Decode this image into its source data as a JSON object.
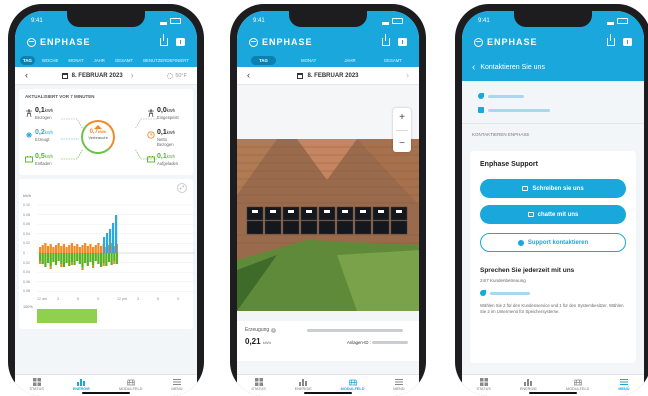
{
  "status": {
    "time": "9:41"
  },
  "brand": {
    "name": "ENPHASE",
    "color": "#1aa7dc"
  },
  "phone1": {
    "tabs": [
      "TAG",
      "WOCHE",
      "MONAT",
      "JAHR",
      "GESAMT",
      "BENUTZERDEFINIERT"
    ],
    "active_tab": "TAG",
    "date": "8. FEBRUAR 2023",
    "temperature": "50°F",
    "updated": "AKTUALISIERT VOR 7 MINUTEN",
    "flows": {
      "bezogen": {
        "value": "0,1",
        "unit": "kWh",
        "label": "Bezogen"
      },
      "eingespeist": {
        "value": "0,0",
        "unit": "kWh",
        "label": "Eingespeist"
      },
      "erzeugt": {
        "value": "0,2",
        "unit": "kWh",
        "label": "Erzeugt"
      },
      "netto": {
        "value": "0,1",
        "unit": "kWh",
        "label": "Netto Bezogen"
      },
      "entladen": {
        "value": "0,5",
        "unit": "kWh",
        "label": "Entladen"
      },
      "aufgeladen": {
        "value": "0,1",
        "unit": "kWh",
        "label": "Aufgeladen"
      },
      "verbraucht": {
        "value": "0,7",
        "unit": "kWh",
        "label": "Verbraucht"
      }
    },
    "chart": {
      "unit_label": "kWh",
      "y_ticks": [
        "0.10",
        "0.08",
        "0.06",
        "0.04",
        "0.02",
        "0",
        "0.02",
        "0.04",
        "0.06",
        "0.08"
      ],
      "x_ticks": [
        "12 am",
        "3",
        "6",
        "9",
        "12 pm",
        "3",
        "6",
        "9"
      ],
      "soc_label": "100%"
    },
    "nav": [
      "STATUS",
      "ENERGIE",
      "MODULFELD",
      "MENÜ"
    ],
    "active_nav": "ENERGIE"
  },
  "phone2": {
    "tabs": [
      "TAG",
      "MONAT",
      "JAHR",
      "GESAMT"
    ],
    "active_tab": "TAG",
    "date": "8. FEBRUAR 2023",
    "production_label": "Erzeugung",
    "production_value": "0,21",
    "production_unit": "kWh",
    "anlagen_label": "Anlagen-ID :",
    "zoom_in": "+",
    "zoom_out": "−",
    "nav": [
      "STATUS",
      "ENERGIE",
      "MODULFELD",
      "MENÜ"
    ],
    "active_nav": "MODULFELD"
  },
  "phone3": {
    "back_title": "Kontaktieren Sie uns",
    "section": "KONTAKTIEREN ENPHASE",
    "support_title": "Enphase Support",
    "btn_write": "Schreiben sie uns",
    "btn_chat": "chatte mit uns",
    "btn_contact": "Support kontaktieren",
    "speak_title": "Sprechen Sie jederzeit mit uns",
    "speak_sub": "24/7 Kundenbetreuung",
    "speak_desc": "Wählen Sie 2 für den Kundenservice und 1 für den Systembesitzer. Wählen Sie 2 im Untermenü für Speichersysteme.",
    "nav": [
      "STATUS",
      "ENERGIE",
      "MODULFELD",
      "MENÜ"
    ],
    "active_nav": "MENÜ"
  }
}
